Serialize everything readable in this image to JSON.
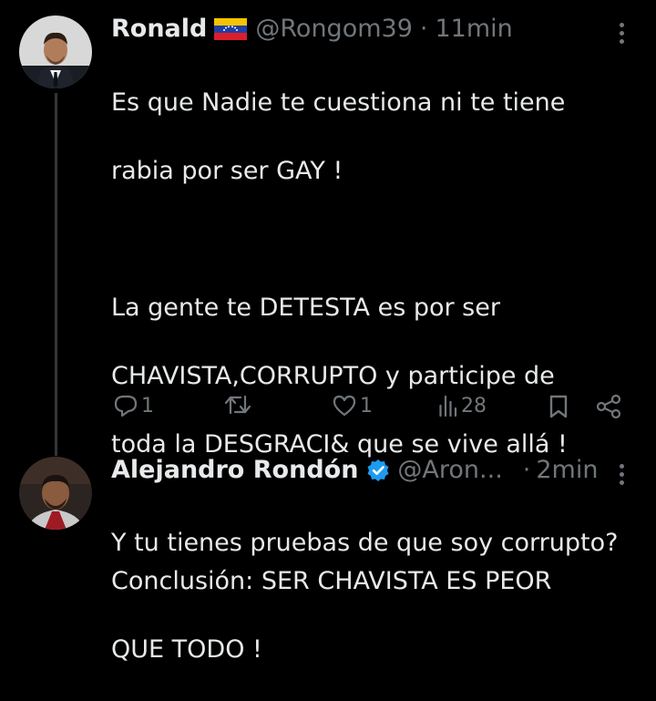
{
  "tweets": [
    {
      "name": "Ronald",
      "flag": "venezuela-flag",
      "handle": "@Rongom39",
      "separator": "·",
      "time": "11min",
      "lines": [
        "Es que Nadie te cuestiona ni te tiene",
        "rabia por ser GAY !",
        "",
        "La gente te DETESTA es por ser",
        "CHAVISTA,CORRUPTO y participe de",
        "toda la DESGRACI& que se vive allá !",
        "",
        "Conclusión: SER CHAVISTA ES PEOR",
        "QUE TODO !"
      ],
      "actions": {
        "replies": "1",
        "retweets": "",
        "likes": "1",
        "views": "28"
      }
    },
    {
      "name": "Alejandro Rondón",
      "verified": true,
      "handle": "@Aron...",
      "separator": "·",
      "time": "2min",
      "lines": [
        "Y tu tienes pruebas de que soy corrupto?"
      ]
    }
  ],
  "colors": {
    "background": "#000000",
    "text": "#e7e9ea",
    "secondary": "#71767b",
    "verified": "#1d9bf0",
    "thread_line": "#333639"
  },
  "icons": [
    "reply-icon",
    "retweet-icon",
    "like-icon",
    "views-icon",
    "bookmark-icon",
    "share-icon",
    "more-icon",
    "verified-badge-icon",
    "venezuela-flag"
  ]
}
